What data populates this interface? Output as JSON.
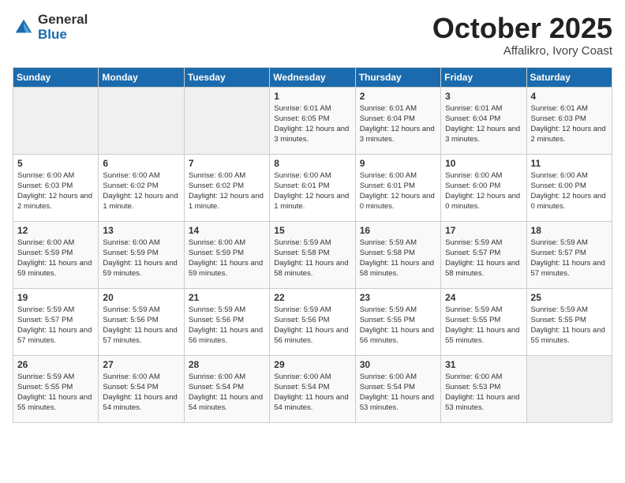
{
  "logo": {
    "general": "General",
    "blue": "Blue"
  },
  "title": "October 2025",
  "location": "Affalikro, Ivory Coast",
  "days_of_week": [
    "Sunday",
    "Monday",
    "Tuesday",
    "Wednesday",
    "Thursday",
    "Friday",
    "Saturday"
  ],
  "weeks": [
    [
      {
        "day": "",
        "info": ""
      },
      {
        "day": "",
        "info": ""
      },
      {
        "day": "",
        "info": ""
      },
      {
        "day": "1",
        "info": "Sunrise: 6:01 AM\nSunset: 6:05 PM\nDaylight: 12 hours and 3 minutes."
      },
      {
        "day": "2",
        "info": "Sunrise: 6:01 AM\nSunset: 6:04 PM\nDaylight: 12 hours and 3 minutes."
      },
      {
        "day": "3",
        "info": "Sunrise: 6:01 AM\nSunset: 6:04 PM\nDaylight: 12 hours and 3 minutes."
      },
      {
        "day": "4",
        "info": "Sunrise: 6:01 AM\nSunset: 6:03 PM\nDaylight: 12 hours and 2 minutes."
      }
    ],
    [
      {
        "day": "5",
        "info": "Sunrise: 6:00 AM\nSunset: 6:03 PM\nDaylight: 12 hours and 2 minutes."
      },
      {
        "day": "6",
        "info": "Sunrise: 6:00 AM\nSunset: 6:02 PM\nDaylight: 12 hours and 1 minute."
      },
      {
        "day": "7",
        "info": "Sunrise: 6:00 AM\nSunset: 6:02 PM\nDaylight: 12 hours and 1 minute."
      },
      {
        "day": "8",
        "info": "Sunrise: 6:00 AM\nSunset: 6:01 PM\nDaylight: 12 hours and 1 minute."
      },
      {
        "day": "9",
        "info": "Sunrise: 6:00 AM\nSunset: 6:01 PM\nDaylight: 12 hours and 0 minutes."
      },
      {
        "day": "10",
        "info": "Sunrise: 6:00 AM\nSunset: 6:00 PM\nDaylight: 12 hours and 0 minutes."
      },
      {
        "day": "11",
        "info": "Sunrise: 6:00 AM\nSunset: 6:00 PM\nDaylight: 12 hours and 0 minutes."
      }
    ],
    [
      {
        "day": "12",
        "info": "Sunrise: 6:00 AM\nSunset: 5:59 PM\nDaylight: 11 hours and 59 minutes."
      },
      {
        "day": "13",
        "info": "Sunrise: 6:00 AM\nSunset: 5:59 PM\nDaylight: 11 hours and 59 minutes."
      },
      {
        "day": "14",
        "info": "Sunrise: 6:00 AM\nSunset: 5:59 PM\nDaylight: 11 hours and 59 minutes."
      },
      {
        "day": "15",
        "info": "Sunrise: 5:59 AM\nSunset: 5:58 PM\nDaylight: 11 hours and 58 minutes."
      },
      {
        "day": "16",
        "info": "Sunrise: 5:59 AM\nSunset: 5:58 PM\nDaylight: 11 hours and 58 minutes."
      },
      {
        "day": "17",
        "info": "Sunrise: 5:59 AM\nSunset: 5:57 PM\nDaylight: 11 hours and 58 minutes."
      },
      {
        "day": "18",
        "info": "Sunrise: 5:59 AM\nSunset: 5:57 PM\nDaylight: 11 hours and 57 minutes."
      }
    ],
    [
      {
        "day": "19",
        "info": "Sunrise: 5:59 AM\nSunset: 5:57 PM\nDaylight: 11 hours and 57 minutes."
      },
      {
        "day": "20",
        "info": "Sunrise: 5:59 AM\nSunset: 5:56 PM\nDaylight: 11 hours and 57 minutes."
      },
      {
        "day": "21",
        "info": "Sunrise: 5:59 AM\nSunset: 5:56 PM\nDaylight: 11 hours and 56 minutes."
      },
      {
        "day": "22",
        "info": "Sunrise: 5:59 AM\nSunset: 5:56 PM\nDaylight: 11 hours and 56 minutes."
      },
      {
        "day": "23",
        "info": "Sunrise: 5:59 AM\nSunset: 5:55 PM\nDaylight: 11 hours and 56 minutes."
      },
      {
        "day": "24",
        "info": "Sunrise: 5:59 AM\nSunset: 5:55 PM\nDaylight: 11 hours and 55 minutes."
      },
      {
        "day": "25",
        "info": "Sunrise: 5:59 AM\nSunset: 5:55 PM\nDaylight: 11 hours and 55 minutes."
      }
    ],
    [
      {
        "day": "26",
        "info": "Sunrise: 5:59 AM\nSunset: 5:55 PM\nDaylight: 11 hours and 55 minutes."
      },
      {
        "day": "27",
        "info": "Sunrise: 6:00 AM\nSunset: 5:54 PM\nDaylight: 11 hours and 54 minutes."
      },
      {
        "day": "28",
        "info": "Sunrise: 6:00 AM\nSunset: 5:54 PM\nDaylight: 11 hours and 54 minutes."
      },
      {
        "day": "29",
        "info": "Sunrise: 6:00 AM\nSunset: 5:54 PM\nDaylight: 11 hours and 54 minutes."
      },
      {
        "day": "30",
        "info": "Sunrise: 6:00 AM\nSunset: 5:54 PM\nDaylight: 11 hours and 53 minutes."
      },
      {
        "day": "31",
        "info": "Sunrise: 6:00 AM\nSunset: 5:53 PM\nDaylight: 11 hours and 53 minutes."
      },
      {
        "day": "",
        "info": ""
      }
    ]
  ]
}
